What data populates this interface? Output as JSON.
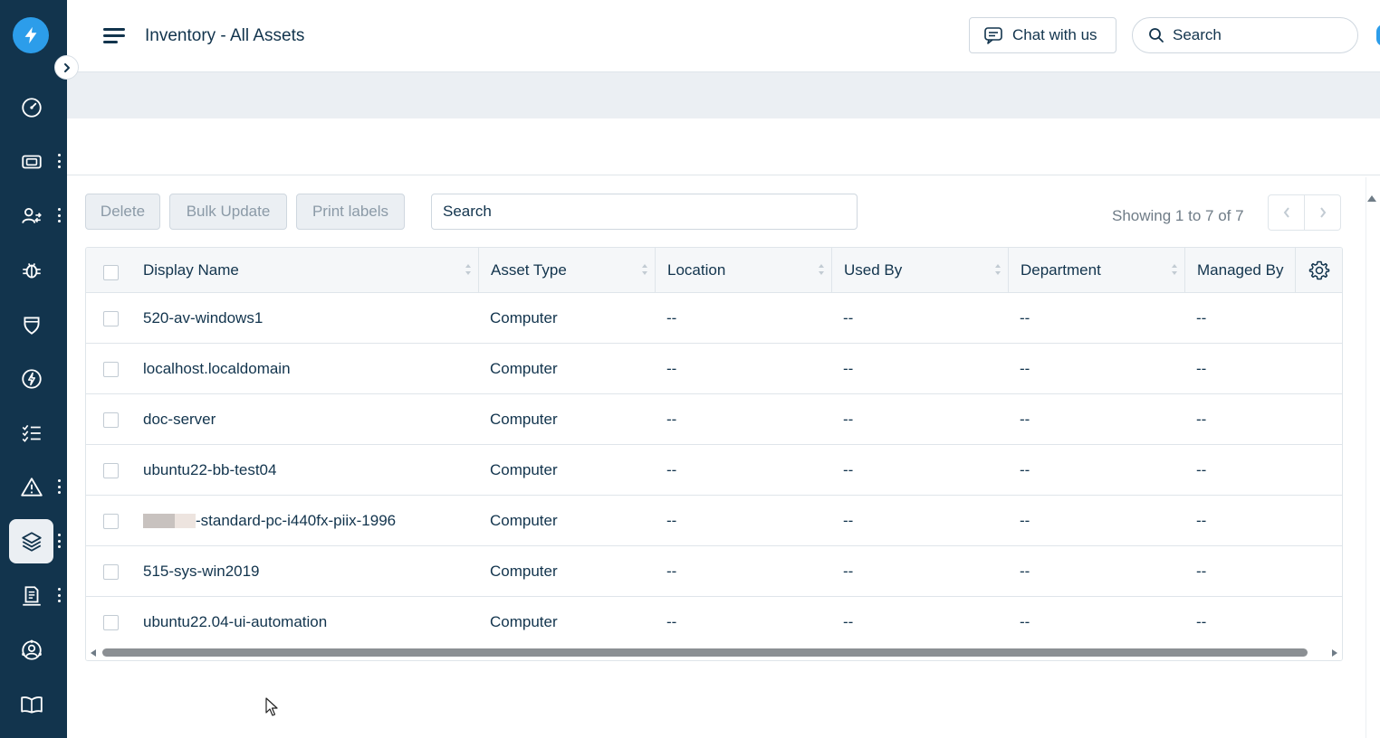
{
  "header": {
    "title": "Inventory - All Assets",
    "chat_label": "Chat with us",
    "search_placeholder": "Search"
  },
  "sidebar": {
    "items": [
      {
        "icon": "dashboard-gauge-icon",
        "has_menu": false,
        "active": false
      },
      {
        "icon": "ticket-icon",
        "has_menu": true,
        "active": false
      },
      {
        "icon": "user-swap-icon",
        "has_menu": true,
        "active": false
      },
      {
        "icon": "bug-icon",
        "has_menu": false,
        "active": false
      },
      {
        "icon": "shield-icon",
        "has_menu": false,
        "active": false
      },
      {
        "icon": "bolt-icon",
        "has_menu": false,
        "active": false
      },
      {
        "icon": "checklist-icon",
        "has_menu": false,
        "active": false
      },
      {
        "icon": "warning-icon",
        "has_menu": true,
        "active": false
      },
      {
        "icon": "layers-icon",
        "has_menu": true,
        "active": true
      },
      {
        "icon": "document-icon",
        "has_menu": true,
        "active": false
      },
      {
        "icon": "user-circle-icon",
        "has_menu": false,
        "active": false
      },
      {
        "icon": "book-icon",
        "has_menu": false,
        "active": false
      }
    ]
  },
  "toolbar": {
    "delete_label": "Delete",
    "bulk_update_label": "Bulk Update",
    "print_labels_label": "Print labels",
    "search_placeholder": "Search",
    "showing_text": "Showing 1 to 7 of 7"
  },
  "table": {
    "columns": [
      "Display Name",
      "Asset Type",
      "Location",
      "Used By",
      "Department",
      "Managed By"
    ],
    "rows": [
      {
        "name": "520-av-windows1",
        "redacted_prefix": false,
        "type": "Computer",
        "location": "--",
        "used_by": "--",
        "department": "--",
        "managed_by": "--"
      },
      {
        "name": "localhost.localdomain",
        "redacted_prefix": false,
        "type": "Computer",
        "location": "--",
        "used_by": "--",
        "department": "--",
        "managed_by": "--"
      },
      {
        "name": "doc-server",
        "redacted_prefix": false,
        "type": "Computer",
        "location": "--",
        "used_by": "--",
        "department": "--",
        "managed_by": "--"
      },
      {
        "name": "ubuntu22-bb-test04",
        "redacted_prefix": false,
        "type": "Computer",
        "location": "--",
        "used_by": "--",
        "department": "--",
        "managed_by": "--"
      },
      {
        "name": "-standard-pc-i440fx-piix-1996",
        "redacted_prefix": true,
        "type": "Computer",
        "location": "--",
        "used_by": "--",
        "department": "--",
        "managed_by": "--"
      },
      {
        "name": "515-sys-win2019",
        "redacted_prefix": false,
        "type": "Computer",
        "location": "--",
        "used_by": "--",
        "department": "--",
        "managed_by": "--"
      },
      {
        "name": "ubuntu22.04-ui-automation",
        "redacted_prefix": false,
        "type": "Computer",
        "location": "--",
        "used_by": "--",
        "department": "--",
        "managed_by": "--"
      }
    ]
  },
  "colors": {
    "sidebar_bg": "#12344d",
    "accent": "#2c9dea",
    "text": "#12344d",
    "band": "#ebeff3"
  }
}
